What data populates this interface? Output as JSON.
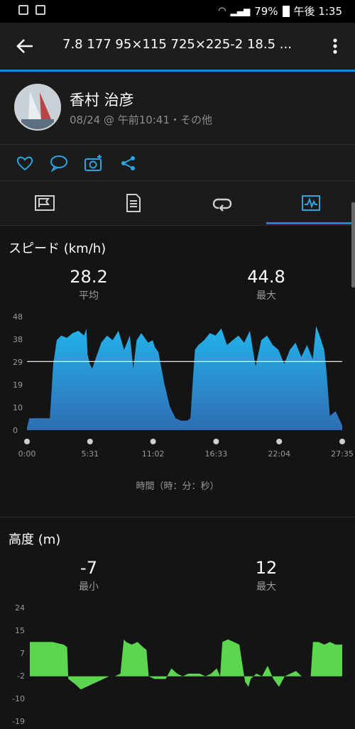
{
  "status_bar": {
    "battery": "79%",
    "time": "午後 1:35"
  },
  "app_bar": {
    "title": "7.8 177 95×115 725×225-2 18.5 ..."
  },
  "profile": {
    "name": "香村 治彦",
    "meta": "08/24 @ 午前10:41・その他"
  },
  "speed": {
    "title": "スピード (km/h)",
    "avg_value": "28.2",
    "avg_label": "平均",
    "max_value": "44.8",
    "max_label": "最大"
  },
  "altitude": {
    "title": "高度 (m)",
    "min_value": "-7",
    "min_label": "最小",
    "max_value": "12",
    "max_label": "最大"
  },
  "x_axis_title": "時間（時：分：秒）",
  "chart_data": [
    {
      "type": "area",
      "title": "スピード (km/h)",
      "xlabel": "時間（時：分：秒）",
      "ylabel": "",
      "y_ticks": [
        "48",
        "38",
        "29",
        "19",
        "10",
        "0"
      ],
      "x_ticks": [
        "0:00",
        "5:31",
        "11:02",
        "16:33",
        "22:04",
        "27:35"
      ],
      "ylim": [
        0,
        48
      ],
      "xlim_minutes": [
        0,
        27.58
      ],
      "average_line": 29,
      "color": "#29a9e1",
      "series": [
        {
          "x": [
            0,
            0.2,
            0.5,
            1.0,
            1.5,
            2.0,
            2.3,
            2.6,
            3.0,
            3.5,
            4.0,
            4.5,
            5.0,
            5.2,
            5.3,
            5.5,
            5.7,
            6.5,
            7.0,
            7.5,
            8.0,
            8.5,
            9.0,
            9.3,
            9.6,
            10.0,
            10.3,
            10.6,
            11.0,
            11.2,
            11.5,
            12.0,
            12.5,
            13.0,
            13.5,
            14.0,
            14.3,
            14.5,
            14.7,
            15.0,
            15.5,
            16.0,
            16.5,
            17.0,
            17.5,
            18.0,
            18.5,
            19.0,
            19.5,
            20.0,
            20.5,
            21.0,
            21.5,
            22.0,
            22.5,
            23.0,
            23.5,
            24.0,
            24.5,
            25.0,
            25.3,
            25.6,
            26.0,
            26.2,
            26.5,
            27.0,
            27.58
          ],
          "y": [
            1,
            5,
            5,
            5,
            5,
            5,
            28,
            38,
            40,
            39,
            41,
            42,
            40,
            43,
            32,
            28,
            26,
            37,
            40,
            38,
            42,
            34,
            40,
            26,
            38,
            41,
            39,
            37,
            38,
            35,
            33,
            20,
            10,
            5,
            4,
            4,
            5,
            20,
            34,
            36,
            38,
            41,
            40,
            43,
            36,
            38,
            40,
            37,
            42,
            27,
            38,
            40,
            36,
            34,
            28,
            34,
            37,
            31,
            36,
            30,
            44,
            40,
            34,
            25,
            6,
            8,
            2
          ]
        }
      ]
    },
    {
      "type": "area",
      "title": "高度 (m)",
      "y_ticks": [
        "24",
        "15",
        "7",
        "-2",
        "-10",
        "-19"
      ],
      "ylim": [
        -19,
        24
      ],
      "baseline": -2,
      "color": "#5dd64f",
      "series": [
        {
          "x": [
            0,
            0.3,
            1.0,
            2.0,
            3.0,
            3.3,
            3.4,
            4.0,
            4.5,
            5.0,
            6.0,
            7.0,
            7.5,
            8.0,
            8.3,
            8.5,
            9.0,
            9.5,
            10.0,
            10.3,
            10.5,
            11.0,
            11.5,
            12.0,
            12.5,
            13.0,
            13.5,
            14.0,
            15.0,
            15.5,
            16.0,
            16.5,
            16.8,
            17.0,
            17.5,
            18.0,
            18.5,
            19.0,
            19.3,
            19.5,
            20.0,
            20.5,
            21.0,
            21.5,
            22.0,
            22.5,
            23.0,
            23.5,
            24.0,
            24.5,
            24.8,
            25.0,
            25.5,
            26.0,
            26.5,
            27.0,
            27.3,
            27.58
          ],
          "y": [
            11,
            11,
            11,
            11,
            10,
            9,
            -3,
            -5,
            -7,
            -6,
            -4,
            -2,
            -2,
            -1,
            12,
            11,
            10,
            11,
            9,
            8,
            -2,
            -3,
            -3,
            -3,
            1,
            -1,
            -2,
            -1,
            -1,
            -2,
            -1,
            1,
            -2,
            11,
            12,
            11,
            10,
            -4,
            -6,
            -3,
            -1,
            -2,
            2,
            -3,
            -6,
            -2,
            -1,
            0,
            -2,
            -2,
            -2,
            11,
            11,
            10,
            11,
            10,
            10,
            10
          ]
        }
      ]
    }
  ]
}
